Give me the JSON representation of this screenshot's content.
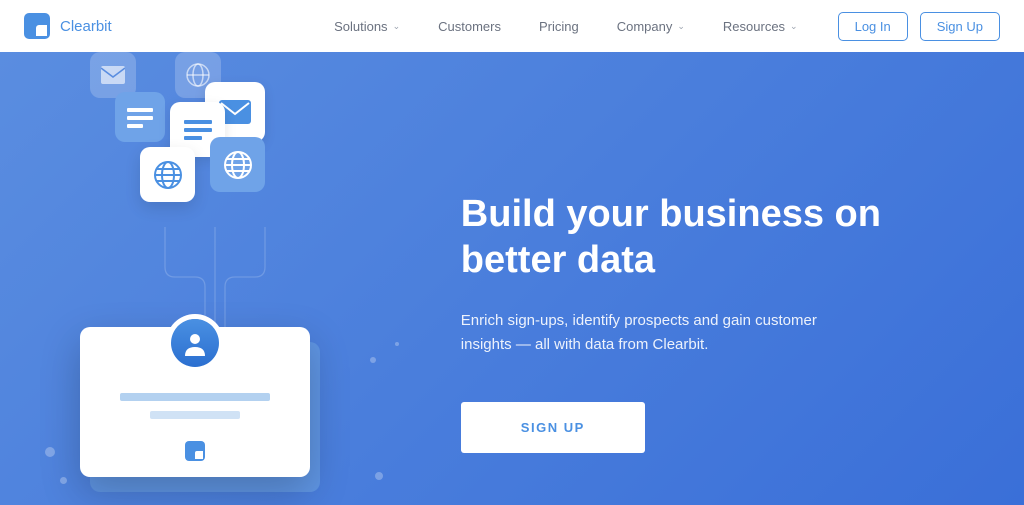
{
  "brand": "Clearbit",
  "nav": {
    "solutions": "Solutions",
    "customers": "Customers",
    "pricing": "Pricing",
    "company": "Company",
    "resources": "Resources"
  },
  "auth": {
    "login": "Log In",
    "signup": "Sign Up"
  },
  "hero": {
    "title": "Build your business on better data",
    "subtitle": "Enrich sign-ups, identify prospects and gain customer insights — all with data from Clearbit.",
    "cta": "SIGN UP"
  }
}
